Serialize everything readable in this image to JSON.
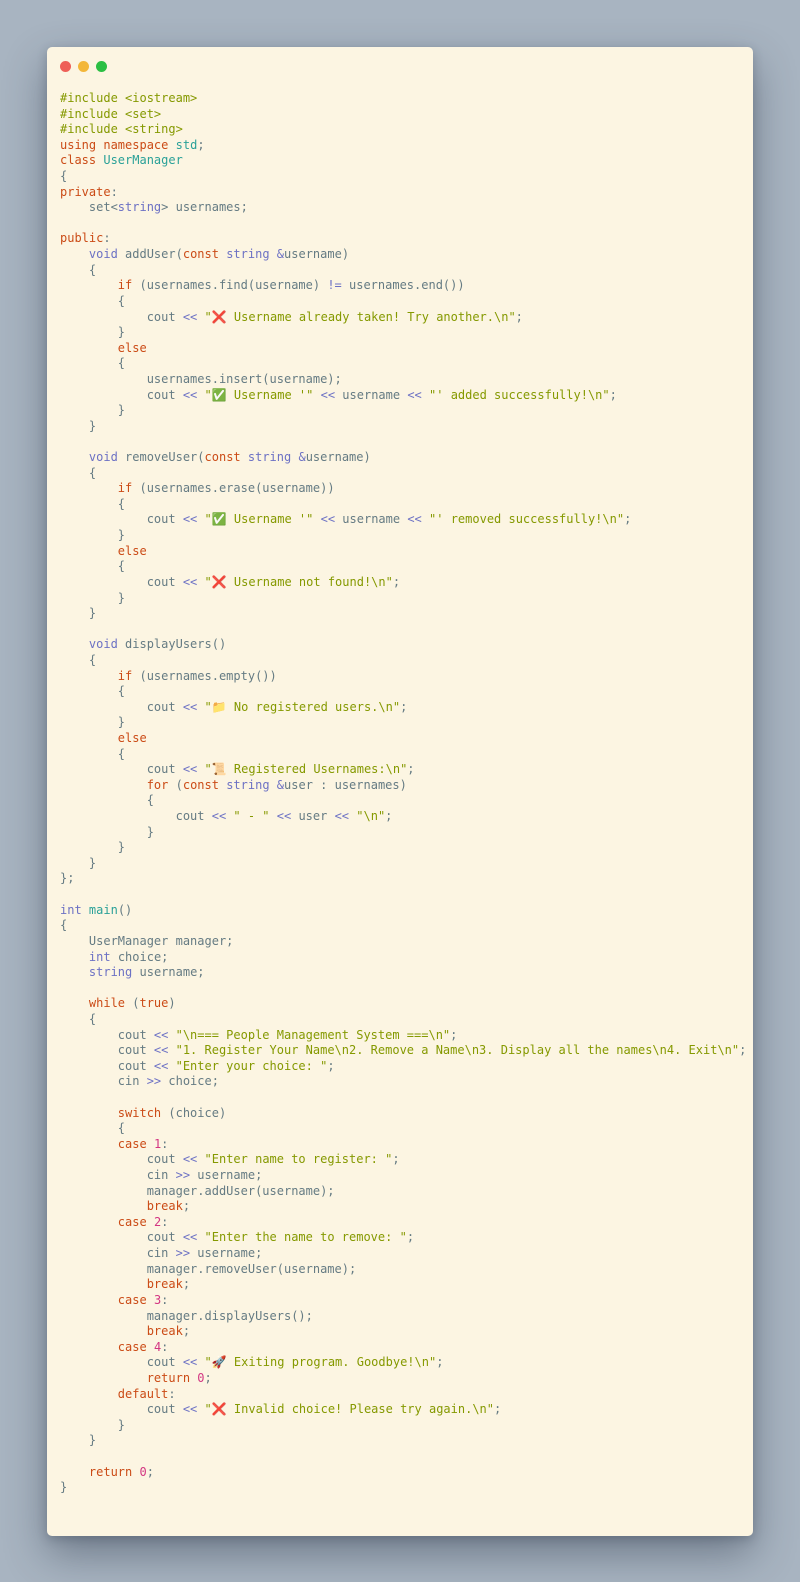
{
  "window": {
    "controls": [
      {
        "name": "close",
        "color": "#ee5f57"
      },
      {
        "name": "minimize",
        "color": "#f3b739"
      },
      {
        "name": "zoom",
        "color": "#2bbf43"
      }
    ],
    "background": "#fcf5e2"
  },
  "editor": {
    "language": "cpp",
    "theme_colors": {
      "preprocessor": "#859900",
      "keyword": "#cb4b16",
      "type": "#6c71c4",
      "class_name": "#2aa198",
      "string": "#859900",
      "number": "#d33682",
      "identifier": "#657b83"
    },
    "lines": [
      [
        [
          "pp",
          "#include <iostream>"
        ]
      ],
      [
        [
          "pp",
          "#include <set>"
        ]
      ],
      [
        [
          "pp",
          "#include <string>"
        ]
      ],
      [
        [
          "kw",
          "using"
        ],
        [
          "id",
          " "
        ],
        [
          "kw",
          "namespace"
        ],
        [
          "id",
          " "
        ],
        [
          "cl",
          "std"
        ],
        [
          "id",
          ";"
        ]
      ],
      [
        [
          "kw",
          "class"
        ],
        [
          "id",
          " "
        ],
        [
          "cl",
          "UserManager"
        ]
      ],
      [
        [
          "id",
          "{"
        ]
      ],
      [
        [
          "kw",
          "private"
        ],
        [
          "id",
          ":"
        ]
      ],
      [
        [
          "id",
          "    set<"
        ],
        [
          "ty",
          "string"
        ],
        [
          "id",
          "> usernames;"
        ]
      ],
      [
        [
          "id",
          ""
        ]
      ],
      [
        [
          "kw",
          "public"
        ],
        [
          "id",
          ":"
        ]
      ],
      [
        [
          "id",
          "    "
        ],
        [
          "ty",
          "void"
        ],
        [
          "id",
          " addUser("
        ],
        [
          "kw",
          "const"
        ],
        [
          "id",
          " "
        ],
        [
          "ty",
          "string"
        ],
        [
          "id",
          " "
        ],
        [
          "op",
          "&"
        ],
        [
          "id",
          "username)"
        ]
      ],
      [
        [
          "id",
          "    {"
        ]
      ],
      [
        [
          "id",
          "        "
        ],
        [
          "kw",
          "if"
        ],
        [
          "id",
          " (usernames.find(username) "
        ],
        [
          "op",
          "!="
        ],
        [
          "id",
          " usernames.end())"
        ]
      ],
      [
        [
          "id",
          "        {"
        ]
      ],
      [
        [
          "id",
          "            cout "
        ],
        [
          "op",
          "<<"
        ],
        [
          "id",
          " "
        ],
        [
          "st",
          "\"❌ Username already taken! Try another.\\n\""
        ],
        [
          "id",
          ";"
        ]
      ],
      [
        [
          "id",
          "        }"
        ]
      ],
      [
        [
          "id",
          "        "
        ],
        [
          "kw",
          "else"
        ]
      ],
      [
        [
          "id",
          "        {"
        ]
      ],
      [
        [
          "id",
          "            usernames.insert(username);"
        ]
      ],
      [
        [
          "id",
          "            cout "
        ],
        [
          "op",
          "<<"
        ],
        [
          "id",
          " "
        ],
        [
          "st",
          "\"✅ Username '\""
        ],
        [
          "id",
          " "
        ],
        [
          "op",
          "<<"
        ],
        [
          "id",
          " username "
        ],
        [
          "op",
          "<<"
        ],
        [
          "id",
          " "
        ],
        [
          "st",
          "\"' added successfully!\\n\""
        ],
        [
          "id",
          ";"
        ]
      ],
      [
        [
          "id",
          "        }"
        ]
      ],
      [
        [
          "id",
          "    }"
        ]
      ],
      [
        [
          "id",
          ""
        ]
      ],
      [
        [
          "id",
          "    "
        ],
        [
          "ty",
          "void"
        ],
        [
          "id",
          " removeUser("
        ],
        [
          "kw",
          "const"
        ],
        [
          "id",
          " "
        ],
        [
          "ty",
          "string"
        ],
        [
          "id",
          " "
        ],
        [
          "op",
          "&"
        ],
        [
          "id",
          "username)"
        ]
      ],
      [
        [
          "id",
          "    {"
        ]
      ],
      [
        [
          "id",
          "        "
        ],
        [
          "kw",
          "if"
        ],
        [
          "id",
          " (usernames.erase(username))"
        ]
      ],
      [
        [
          "id",
          "        {"
        ]
      ],
      [
        [
          "id",
          "            cout "
        ],
        [
          "op",
          "<<"
        ],
        [
          "id",
          " "
        ],
        [
          "st",
          "\"✅ Username '\""
        ],
        [
          "id",
          " "
        ],
        [
          "op",
          "<<"
        ],
        [
          "id",
          " username "
        ],
        [
          "op",
          "<<"
        ],
        [
          "id",
          " "
        ],
        [
          "st",
          "\"' removed successfully!\\n\""
        ],
        [
          "id",
          ";"
        ]
      ],
      [
        [
          "id",
          "        }"
        ]
      ],
      [
        [
          "id",
          "        "
        ],
        [
          "kw",
          "else"
        ]
      ],
      [
        [
          "id",
          "        {"
        ]
      ],
      [
        [
          "id",
          "            cout "
        ],
        [
          "op",
          "<<"
        ],
        [
          "id",
          " "
        ],
        [
          "st",
          "\"❌ Username not found!\\n\""
        ],
        [
          "id",
          ";"
        ]
      ],
      [
        [
          "id",
          "        }"
        ]
      ],
      [
        [
          "id",
          "    }"
        ]
      ],
      [
        [
          "id",
          ""
        ]
      ],
      [
        [
          "id",
          "    "
        ],
        [
          "ty",
          "void"
        ],
        [
          "id",
          " displayUsers()"
        ]
      ],
      [
        [
          "id",
          "    {"
        ]
      ],
      [
        [
          "id",
          "        "
        ],
        [
          "kw",
          "if"
        ],
        [
          "id",
          " (usernames.empty())"
        ]
      ],
      [
        [
          "id",
          "        {"
        ]
      ],
      [
        [
          "id",
          "            cout "
        ],
        [
          "op",
          "<<"
        ],
        [
          "id",
          " "
        ],
        [
          "st",
          "\"📁 No registered users.\\n\""
        ],
        [
          "id",
          ";"
        ]
      ],
      [
        [
          "id",
          "        }"
        ]
      ],
      [
        [
          "id",
          "        "
        ],
        [
          "kw",
          "else"
        ]
      ],
      [
        [
          "id",
          "        {"
        ]
      ],
      [
        [
          "id",
          "            cout "
        ],
        [
          "op",
          "<<"
        ],
        [
          "id",
          " "
        ],
        [
          "st",
          "\"📜 Registered Usernames:\\n\""
        ],
        [
          "id",
          ";"
        ]
      ],
      [
        [
          "id",
          "            "
        ],
        [
          "kw",
          "for"
        ],
        [
          "id",
          " ("
        ],
        [
          "kw",
          "const"
        ],
        [
          "id",
          " "
        ],
        [
          "ty",
          "string"
        ],
        [
          "id",
          " "
        ],
        [
          "op",
          "&"
        ],
        [
          "id",
          "user : usernames)"
        ]
      ],
      [
        [
          "id",
          "            {"
        ]
      ],
      [
        [
          "id",
          "                cout "
        ],
        [
          "op",
          "<<"
        ],
        [
          "id",
          " "
        ],
        [
          "st",
          "\" - \""
        ],
        [
          "id",
          " "
        ],
        [
          "op",
          "<<"
        ],
        [
          "id",
          " user "
        ],
        [
          "op",
          "<<"
        ],
        [
          "id",
          " "
        ],
        [
          "st",
          "\"\\n\""
        ],
        [
          "id",
          ";"
        ]
      ],
      [
        [
          "id",
          "            }"
        ]
      ],
      [
        [
          "id",
          "        }"
        ]
      ],
      [
        [
          "id",
          "    }"
        ]
      ],
      [
        [
          "id",
          "};"
        ]
      ],
      [
        [
          "id",
          ""
        ]
      ],
      [
        [
          "ty",
          "int"
        ],
        [
          "id",
          " "
        ],
        [
          "cl",
          "main"
        ],
        [
          "id",
          "()"
        ]
      ],
      [
        [
          "id",
          "{"
        ]
      ],
      [
        [
          "id",
          "    UserManager manager;"
        ]
      ],
      [
        [
          "id",
          "    "
        ],
        [
          "ty",
          "int"
        ],
        [
          "id",
          " choice;"
        ]
      ],
      [
        [
          "id",
          "    "
        ],
        [
          "ty",
          "string"
        ],
        [
          "id",
          " username;"
        ]
      ],
      [
        [
          "id",
          ""
        ]
      ],
      [
        [
          "id",
          "    "
        ],
        [
          "kw",
          "while"
        ],
        [
          "id",
          " ("
        ],
        [
          "kw",
          "true"
        ],
        [
          "id",
          ")"
        ]
      ],
      [
        [
          "id",
          "    {"
        ]
      ],
      [
        [
          "id",
          "        cout "
        ],
        [
          "op",
          "<<"
        ],
        [
          "id",
          " "
        ],
        [
          "st",
          "\"\\n=== People Management System ===\\n\""
        ],
        [
          "id",
          ";"
        ]
      ],
      [
        [
          "id",
          "        cout "
        ],
        [
          "op",
          "<<"
        ],
        [
          "id",
          " "
        ],
        [
          "st",
          "\"1. Register Your Name\\n2. Remove a Name\\n3. Display all the names\\n4. Exit\\n\""
        ],
        [
          "id",
          ";"
        ]
      ],
      [
        [
          "id",
          "        cout "
        ],
        [
          "op",
          "<<"
        ],
        [
          "id",
          " "
        ],
        [
          "st",
          "\"Enter your choice: \""
        ],
        [
          "id",
          ";"
        ]
      ],
      [
        [
          "id",
          "        cin "
        ],
        [
          "op",
          ">>"
        ],
        [
          "id",
          " choice;"
        ]
      ],
      [
        [
          "id",
          ""
        ]
      ],
      [
        [
          "id",
          "        "
        ],
        [
          "kw",
          "switch"
        ],
        [
          "id",
          " (choice)"
        ]
      ],
      [
        [
          "id",
          "        {"
        ]
      ],
      [
        [
          "id",
          "        "
        ],
        [
          "kw",
          "case"
        ],
        [
          "id",
          " "
        ],
        [
          "nm",
          "1"
        ],
        [
          "id",
          ":"
        ]
      ],
      [
        [
          "id",
          "            cout "
        ],
        [
          "op",
          "<<"
        ],
        [
          "id",
          " "
        ],
        [
          "st",
          "\"Enter name to register: \""
        ],
        [
          "id",
          ";"
        ]
      ],
      [
        [
          "id",
          "            cin "
        ],
        [
          "op",
          ">>"
        ],
        [
          "id",
          " username;"
        ]
      ],
      [
        [
          "id",
          "            manager.addUser(username);"
        ]
      ],
      [
        [
          "id",
          "            "
        ],
        [
          "kw",
          "break"
        ],
        [
          "id",
          ";"
        ]
      ],
      [
        [
          "id",
          "        "
        ],
        [
          "kw",
          "case"
        ],
        [
          "id",
          " "
        ],
        [
          "nm",
          "2"
        ],
        [
          "id",
          ":"
        ]
      ],
      [
        [
          "id",
          "            cout "
        ],
        [
          "op",
          "<<"
        ],
        [
          "id",
          " "
        ],
        [
          "st",
          "\"Enter the name to remove: \""
        ],
        [
          "id",
          ";"
        ]
      ],
      [
        [
          "id",
          "            cin "
        ],
        [
          "op",
          ">>"
        ],
        [
          "id",
          " username;"
        ]
      ],
      [
        [
          "id",
          "            manager.removeUser(username);"
        ]
      ],
      [
        [
          "id",
          "            "
        ],
        [
          "kw",
          "break"
        ],
        [
          "id",
          ";"
        ]
      ],
      [
        [
          "id",
          "        "
        ],
        [
          "kw",
          "case"
        ],
        [
          "id",
          " "
        ],
        [
          "nm",
          "3"
        ],
        [
          "id",
          ":"
        ]
      ],
      [
        [
          "id",
          "            manager.displayUsers();"
        ]
      ],
      [
        [
          "id",
          "            "
        ],
        [
          "kw",
          "break"
        ],
        [
          "id",
          ";"
        ]
      ],
      [
        [
          "id",
          "        "
        ],
        [
          "kw",
          "case"
        ],
        [
          "id",
          " "
        ],
        [
          "nm",
          "4"
        ],
        [
          "id",
          ":"
        ]
      ],
      [
        [
          "id",
          "            cout "
        ],
        [
          "op",
          "<<"
        ],
        [
          "id",
          " "
        ],
        [
          "st",
          "\"🚀 Exiting program. Goodbye!\\n\""
        ],
        [
          "id",
          ";"
        ]
      ],
      [
        [
          "id",
          "            "
        ],
        [
          "kw",
          "return"
        ],
        [
          "id",
          " "
        ],
        [
          "nm",
          "0"
        ],
        [
          "id",
          ";"
        ]
      ],
      [
        [
          "id",
          "        "
        ],
        [
          "kw",
          "default"
        ],
        [
          "id",
          ":"
        ]
      ],
      [
        [
          "id",
          "            cout "
        ],
        [
          "op",
          "<<"
        ],
        [
          "id",
          " "
        ],
        [
          "st",
          "\"❌ Invalid choice! Please try again.\\n\""
        ],
        [
          "id",
          ";"
        ]
      ],
      [
        [
          "id",
          "        }"
        ]
      ],
      [
        [
          "id",
          "    }"
        ]
      ],
      [
        [
          "id",
          ""
        ]
      ],
      [
        [
          "id",
          "    "
        ],
        [
          "kw",
          "return"
        ],
        [
          "id",
          " "
        ],
        [
          "nm",
          "0"
        ],
        [
          "id",
          ";"
        ]
      ],
      [
        [
          "id",
          "}"
        ]
      ]
    ]
  }
}
